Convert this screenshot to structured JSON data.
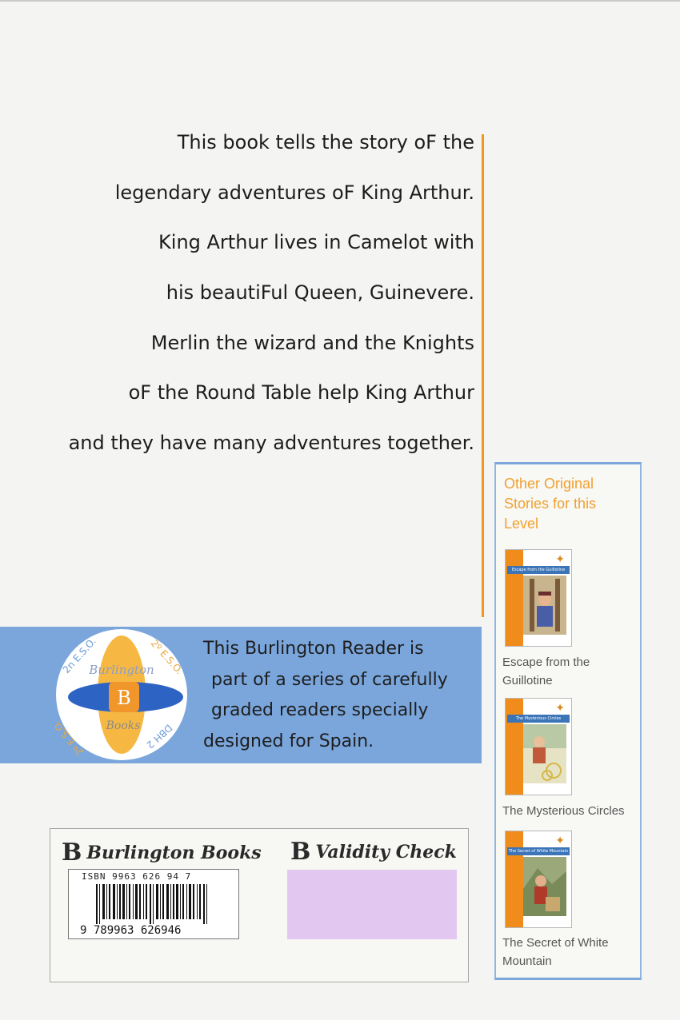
{
  "blurb": {
    "lines": [
      "This book tells the story oF the",
      "legendary adventures oF King Arthur.",
      "King Arthur lives in Camelot with",
      "his beautiFul Queen, Guinevere.",
      "Merlin the wizard and the Knights",
      "oF the Round Table help King Arthur",
      "and they have many adventures together."
    ]
  },
  "banner": {
    "lines": [
      "This Burlington Reader is",
      "part of a series of carefully",
      "graded readers specially",
      "designed for Spain."
    ],
    "badge": {
      "top_left": "2n E.S.O.",
      "top_right": "2º E.S.O.",
      "bottom_left": "2º E.S.O.",
      "bottom_right": "DBH 2",
      "publisher": "Burlington",
      "letter": "B",
      "books": "Books"
    }
  },
  "sidebar": {
    "heading": "Other Original Stories for this Level",
    "books": [
      {
        "title": "Escape from the Guillotine",
        "cover_title": "Escape from the Guillotine"
      },
      {
        "title": "The Mysterious Circles",
        "cover_title": "The Mysterious Circles"
      },
      {
        "title": "The Secret of White Mountain",
        "cover_title": "The Secret of White Mountain"
      }
    ]
  },
  "back_panel": {
    "publisher": "Burlington Books",
    "validity": "Validity Check",
    "isbn": "ISBN 9963 626 94 7",
    "ean": "9 789963 626946",
    "logo_letter": "B"
  },
  "colors": {
    "accent_orange": "#f2961e",
    "banner_blue": "#7aa6dc",
    "validity_lilac": "#e2c8f0"
  }
}
